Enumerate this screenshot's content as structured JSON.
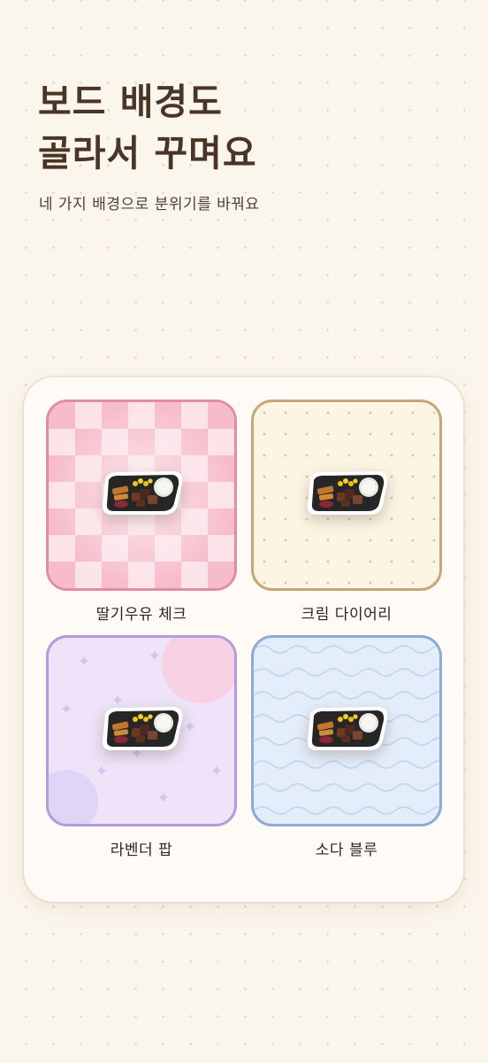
{
  "header": {
    "title_line1": "보드 배경도",
    "title_line2": "골라서 꾸며요",
    "subtitle": "네 가지 배경으로 분위기를 바꿔요"
  },
  "backgrounds": [
    {
      "label": "딸기우유 체크",
      "accent": "#e08ea0",
      "pattern": "checker"
    },
    {
      "label": "크림 다이어리",
      "accent": "#c9a678",
      "pattern": "dots"
    },
    {
      "label": "라벤더 팝",
      "accent": "#b69adb",
      "pattern": "sparkles"
    },
    {
      "label": "소다 블루",
      "accent": "#90aad4",
      "pattern": "waves"
    }
  ],
  "colors": {
    "page_bg": "#fbf6ec",
    "title": "#4a3426"
  }
}
